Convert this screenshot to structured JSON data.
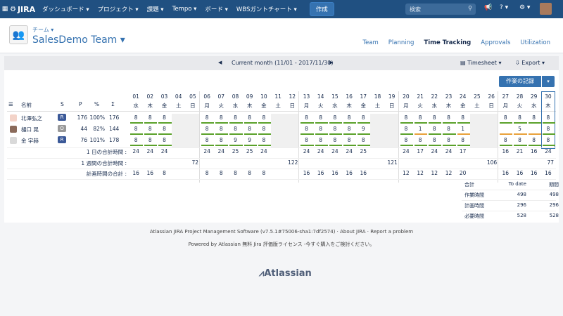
{
  "nav": {
    "logo": "JIRA",
    "items": [
      "ダッシュボード ▾",
      "プロジェクト ▾",
      "課題 ▾",
      "Tempo ▾",
      "ボード ▾",
      "WBSガントチャート ▾"
    ],
    "create": "作成",
    "search_placeholder": "検索"
  },
  "team": {
    "label": "チーム ▾",
    "name": "SalesDemo Team ▾"
  },
  "tabs": [
    "Team",
    "Planning",
    "Time Tracking",
    "Approvals",
    "Utilization"
  ],
  "active_tab": "Time Tracking",
  "toolbar": {
    "month": "Current month (11/01 - 2017/11/30)",
    "timesheet": "Timesheet ▾",
    "export": "Export ▾",
    "log_button": "作業の記録"
  },
  "columns": {
    "name": "名前",
    "s": "S",
    "p": "P",
    "pct": "%",
    "sigma": "Σ"
  },
  "days": [
    [
      "01",
      "水"
    ],
    [
      "02",
      "木"
    ],
    [
      "03",
      "金"
    ],
    [
      "04",
      "土"
    ],
    [
      "05",
      "日"
    ],
    [
      "06",
      "月"
    ],
    [
      "07",
      "火"
    ],
    [
      "08",
      "水"
    ],
    [
      "09",
      "木"
    ],
    [
      "10",
      "金"
    ],
    [
      "11",
      "土"
    ],
    [
      "12",
      "日"
    ],
    [
      "13",
      "月"
    ],
    [
      "14",
      "火"
    ],
    [
      "15",
      "水"
    ],
    [
      "16",
      "木"
    ],
    [
      "17",
      "金"
    ],
    [
      "18",
      "土"
    ],
    [
      "19",
      "日"
    ],
    [
      "20",
      "月"
    ],
    [
      "21",
      "火"
    ],
    [
      "22",
      "水"
    ],
    [
      "23",
      "木"
    ],
    [
      "24",
      "金"
    ],
    [
      "25",
      "土"
    ],
    [
      "26",
      "日"
    ],
    [
      "27",
      "月"
    ],
    [
      "28",
      "火"
    ],
    [
      "29",
      "水"
    ],
    [
      "30",
      "木"
    ]
  ],
  "users": [
    {
      "name": "北澤弘之",
      "s": "R",
      "p": "176",
      "pct": "100%",
      "sigma": "176",
      "hours": [
        "8",
        "8",
        "8",
        "",
        "",
        "8",
        "8",
        "8",
        "8",
        "8",
        "",
        "",
        "8",
        "8",
        "8",
        "8",
        "8",
        "",
        "",
        "8",
        "8",
        "8",
        "8",
        "8",
        "",
        "",
        "8",
        "8",
        "8",
        "8"
      ]
    },
    {
      "name": "樋口 晃",
      "s": "O",
      "p": "44",
      "pct": "82%",
      "sigma": "144",
      "hours": [
        "8",
        "8",
        "8",
        "",
        "",
        "8",
        "8",
        "8",
        "8",
        "8",
        "",
        "",
        "8",
        "8",
        "8",
        "8",
        "9",
        "",
        "",
        "8",
        "1",
        "8",
        "8",
        "1",
        "",
        "",
        "",
        "5",
        "",
        "8"
      ]
    },
    {
      "name": "金 宇赫",
      "s": "R",
      "p": "76",
      "pct": "101%",
      "sigma": "178",
      "hours": [
        "8",
        "8",
        "8",
        "",
        "",
        "8",
        "8",
        "9",
        "9",
        "8",
        "",
        "",
        "8",
        "8",
        "8",
        "8",
        "8",
        "",
        "",
        "8",
        "8",
        "8",
        "8",
        "8",
        "",
        "",
        "8",
        "8",
        "8",
        "8"
      ]
    }
  ],
  "daily_label": "1 日の合計時間 :",
  "daily_totals": [
    "24",
    "24",
    "24",
    "",
    "",
    "24",
    "24",
    "25",
    "25",
    "24",
    "",
    "",
    "24",
    "24",
    "24",
    "24",
    "25",
    "",
    "",
    "24",
    "17",
    "24",
    "24",
    "17",
    "",
    "",
    "16",
    "21",
    "16",
    "24"
  ],
  "weekly_label": "1 週間の合計時間 :",
  "weekly_totals": [
    "72",
    "122",
    "121",
    "106",
    "77"
  ],
  "planned_label": "計画時間の合計 :",
  "planned_totals": [
    "16",
    "16",
    "8",
    "",
    "",
    "8",
    "8",
    "8",
    "8",
    "8",
    "",
    "",
    "16",
    "16",
    "16",
    "16",
    "16",
    "",
    "",
    "12",
    "12",
    "12",
    "12",
    "20",
    "",
    "",
    "16",
    "16",
    "16",
    "16"
  ],
  "summary": {
    "headers": [
      "合計",
      "To date",
      "期間"
    ],
    "rows": [
      [
        "作業時間",
        "498",
        "498"
      ],
      [
        "計画時間",
        "296",
        "296"
      ],
      [
        "必要時間",
        "528",
        "528"
      ]
    ]
  },
  "footer": {
    "line1": "Atlassian JIRA Project Management Software (v7.5.1#75006-sha1:7df2574)  ·  About JIRA  ·  Report a problem",
    "line2": "Powered by Atlassian 無料 Jira 評価版ライセンス -今すぐ購入をご検討ください。",
    "brand": "Atlassian"
  },
  "colors": {
    "nav": "#205081",
    "accent": "#3572b0",
    "bar_green": "#5aa12a",
    "bar_orange": "#e8a13a"
  }
}
